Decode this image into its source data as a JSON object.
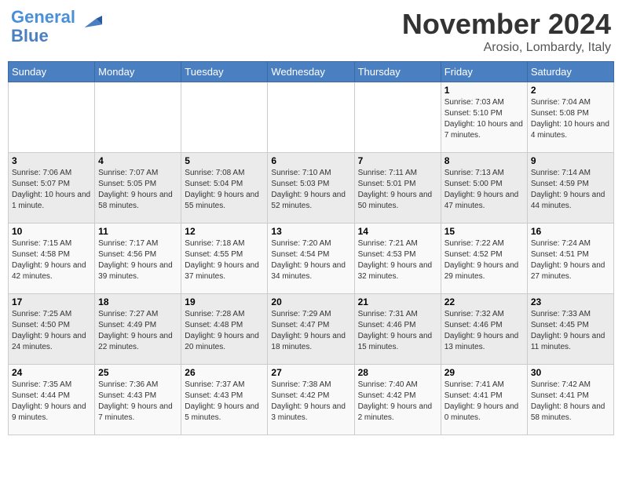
{
  "logo": {
    "line1": "General",
    "line2": "Blue"
  },
  "title": "November 2024",
  "location": "Arosio, Lombardy, Italy",
  "days_of_week": [
    "Sunday",
    "Monday",
    "Tuesday",
    "Wednesday",
    "Thursday",
    "Friday",
    "Saturday"
  ],
  "weeks": [
    [
      {
        "day": "",
        "info": ""
      },
      {
        "day": "",
        "info": ""
      },
      {
        "day": "",
        "info": ""
      },
      {
        "day": "",
        "info": ""
      },
      {
        "day": "",
        "info": ""
      },
      {
        "day": "1",
        "info": "Sunrise: 7:03 AM\nSunset: 5:10 PM\nDaylight: 10 hours and 7 minutes."
      },
      {
        "day": "2",
        "info": "Sunrise: 7:04 AM\nSunset: 5:08 PM\nDaylight: 10 hours and 4 minutes."
      }
    ],
    [
      {
        "day": "3",
        "info": "Sunrise: 7:06 AM\nSunset: 5:07 PM\nDaylight: 10 hours and 1 minute."
      },
      {
        "day": "4",
        "info": "Sunrise: 7:07 AM\nSunset: 5:05 PM\nDaylight: 9 hours and 58 minutes."
      },
      {
        "day": "5",
        "info": "Sunrise: 7:08 AM\nSunset: 5:04 PM\nDaylight: 9 hours and 55 minutes."
      },
      {
        "day": "6",
        "info": "Sunrise: 7:10 AM\nSunset: 5:03 PM\nDaylight: 9 hours and 52 minutes."
      },
      {
        "day": "7",
        "info": "Sunrise: 7:11 AM\nSunset: 5:01 PM\nDaylight: 9 hours and 50 minutes."
      },
      {
        "day": "8",
        "info": "Sunrise: 7:13 AM\nSunset: 5:00 PM\nDaylight: 9 hours and 47 minutes."
      },
      {
        "day": "9",
        "info": "Sunrise: 7:14 AM\nSunset: 4:59 PM\nDaylight: 9 hours and 44 minutes."
      }
    ],
    [
      {
        "day": "10",
        "info": "Sunrise: 7:15 AM\nSunset: 4:58 PM\nDaylight: 9 hours and 42 minutes."
      },
      {
        "day": "11",
        "info": "Sunrise: 7:17 AM\nSunset: 4:56 PM\nDaylight: 9 hours and 39 minutes."
      },
      {
        "day": "12",
        "info": "Sunrise: 7:18 AM\nSunset: 4:55 PM\nDaylight: 9 hours and 37 minutes."
      },
      {
        "day": "13",
        "info": "Sunrise: 7:20 AM\nSunset: 4:54 PM\nDaylight: 9 hours and 34 minutes."
      },
      {
        "day": "14",
        "info": "Sunrise: 7:21 AM\nSunset: 4:53 PM\nDaylight: 9 hours and 32 minutes."
      },
      {
        "day": "15",
        "info": "Sunrise: 7:22 AM\nSunset: 4:52 PM\nDaylight: 9 hours and 29 minutes."
      },
      {
        "day": "16",
        "info": "Sunrise: 7:24 AM\nSunset: 4:51 PM\nDaylight: 9 hours and 27 minutes."
      }
    ],
    [
      {
        "day": "17",
        "info": "Sunrise: 7:25 AM\nSunset: 4:50 PM\nDaylight: 9 hours and 24 minutes."
      },
      {
        "day": "18",
        "info": "Sunrise: 7:27 AM\nSunset: 4:49 PM\nDaylight: 9 hours and 22 minutes."
      },
      {
        "day": "19",
        "info": "Sunrise: 7:28 AM\nSunset: 4:48 PM\nDaylight: 9 hours and 20 minutes."
      },
      {
        "day": "20",
        "info": "Sunrise: 7:29 AM\nSunset: 4:47 PM\nDaylight: 9 hours and 18 minutes."
      },
      {
        "day": "21",
        "info": "Sunrise: 7:31 AM\nSunset: 4:46 PM\nDaylight: 9 hours and 15 minutes."
      },
      {
        "day": "22",
        "info": "Sunrise: 7:32 AM\nSunset: 4:46 PM\nDaylight: 9 hours and 13 minutes."
      },
      {
        "day": "23",
        "info": "Sunrise: 7:33 AM\nSunset: 4:45 PM\nDaylight: 9 hours and 11 minutes."
      }
    ],
    [
      {
        "day": "24",
        "info": "Sunrise: 7:35 AM\nSunset: 4:44 PM\nDaylight: 9 hours and 9 minutes."
      },
      {
        "day": "25",
        "info": "Sunrise: 7:36 AM\nSunset: 4:43 PM\nDaylight: 9 hours and 7 minutes."
      },
      {
        "day": "26",
        "info": "Sunrise: 7:37 AM\nSunset: 4:43 PM\nDaylight: 9 hours and 5 minutes."
      },
      {
        "day": "27",
        "info": "Sunrise: 7:38 AM\nSunset: 4:42 PM\nDaylight: 9 hours and 3 minutes."
      },
      {
        "day": "28",
        "info": "Sunrise: 7:40 AM\nSunset: 4:42 PM\nDaylight: 9 hours and 2 minutes."
      },
      {
        "day": "29",
        "info": "Sunrise: 7:41 AM\nSunset: 4:41 PM\nDaylight: 9 hours and 0 minutes."
      },
      {
        "day": "30",
        "info": "Sunrise: 7:42 AM\nSunset: 4:41 PM\nDaylight: 8 hours and 58 minutes."
      }
    ]
  ]
}
